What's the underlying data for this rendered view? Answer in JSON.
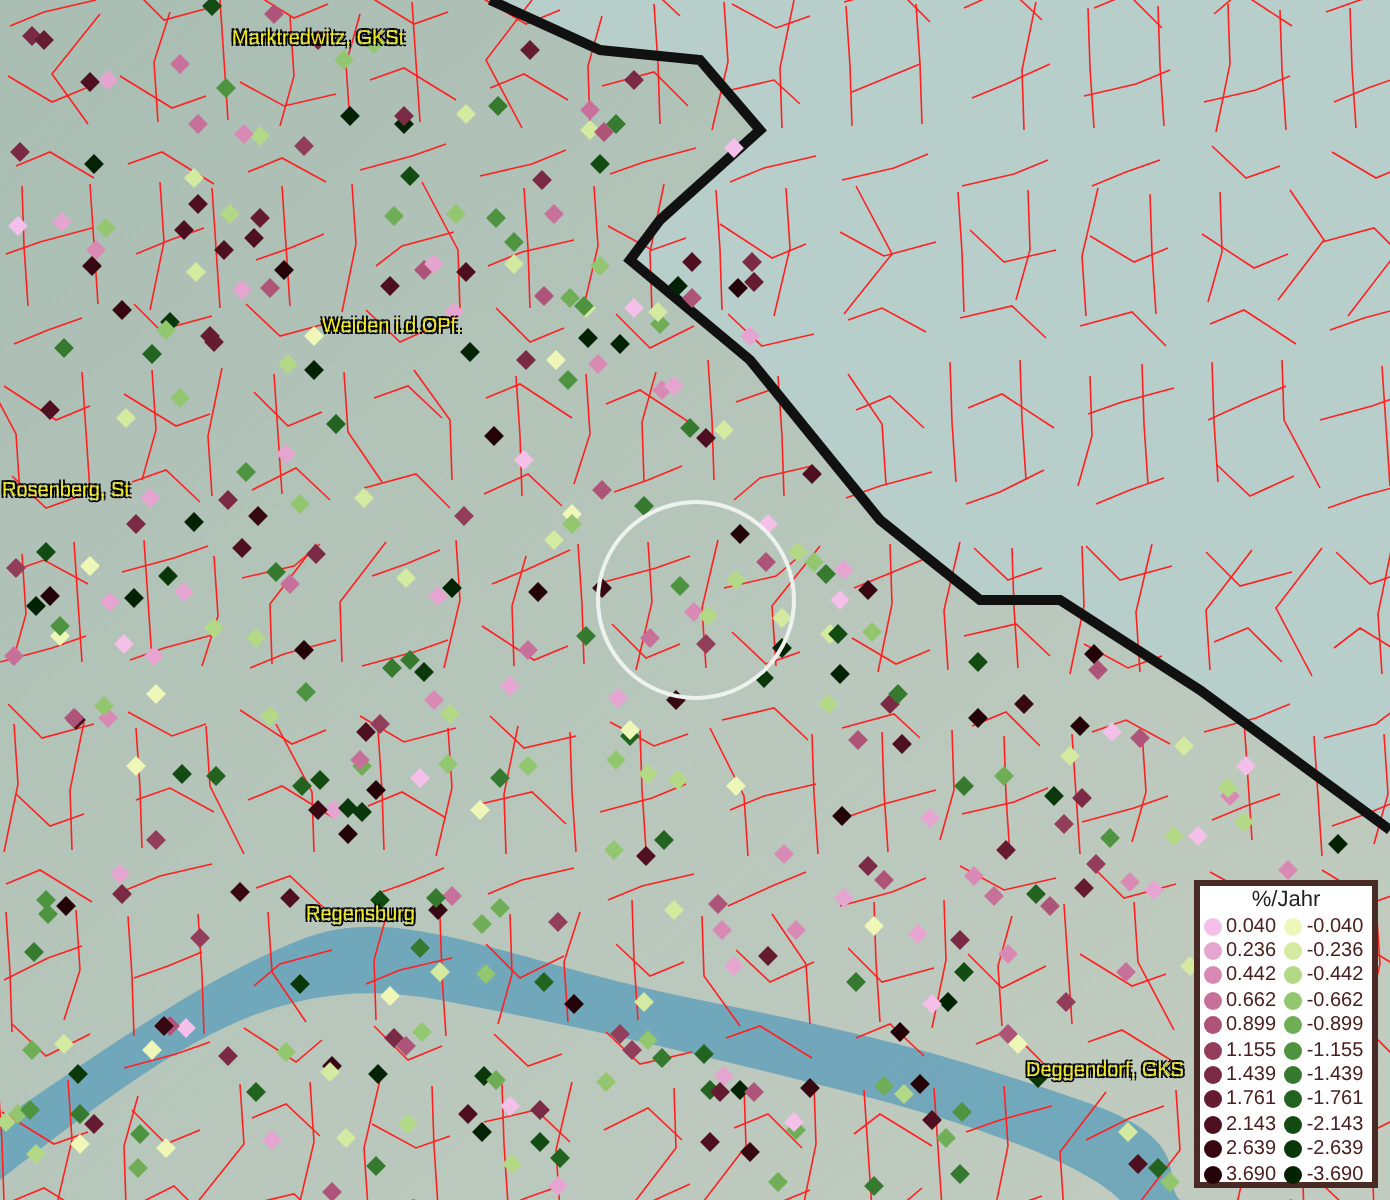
{
  "map": {
    "places": [
      {
        "name": "Marktredwitz, GKSt",
        "kind": "town"
      },
      {
        "name": "Weiden i.d.OPf.",
        "kind": "town"
      },
      {
        "name": "Rosenberg, St",
        "kind": "town"
      },
      {
        "name": "Regensburg",
        "kind": "town"
      },
      {
        "name": "Deggendorf, GKS",
        "kind": "town"
      }
    ]
  },
  "legend": {
    "title": "%/Jahr",
    "items": [
      {
        "label": "0.040",
        "color": "#f4bfe8"
      },
      {
        "label": "0.236",
        "color": "#e6a4d0"
      },
      {
        "label": "0.442",
        "color": "#d88ab5"
      },
      {
        "label": "0.662",
        "color": "#c6709a"
      },
      {
        "label": "0.899",
        "color": "#ad5478"
      },
      {
        "label": "1.155",
        "color": "#923e5b"
      },
      {
        "label": "1.439",
        "color": "#7a2a44"
      },
      {
        "label": "1.761",
        "color": "#661c30"
      },
      {
        "label": "2.143",
        "color": "#4e1020"
      },
      {
        "label": "2.639",
        "color": "#380812"
      },
      {
        "label": "3.690",
        "color": "#240308"
      },
      {
        "label": "-0.040",
        "color": "#eef7b8"
      },
      {
        "label": "-0.236",
        "color": "#d3eaa0"
      },
      {
        "label": "-0.442",
        "color": "#b3d987"
      },
      {
        "label": "-0.662",
        "color": "#92c66f"
      },
      {
        "label": "-0.899",
        "color": "#6fae56"
      },
      {
        "label": "-1.155",
        "color": "#4e9440"
      },
      {
        "label": "-1.439",
        "color": "#357a2e"
      },
      {
        "label": "-1.761",
        "color": "#22631f"
      },
      {
        "label": "-2.143",
        "color": "#124c12"
      },
      {
        "label": "-2.639",
        "color": "#0a380a"
      },
      {
        "label": "-3.690",
        "color": "#042304"
      }
    ]
  }
}
